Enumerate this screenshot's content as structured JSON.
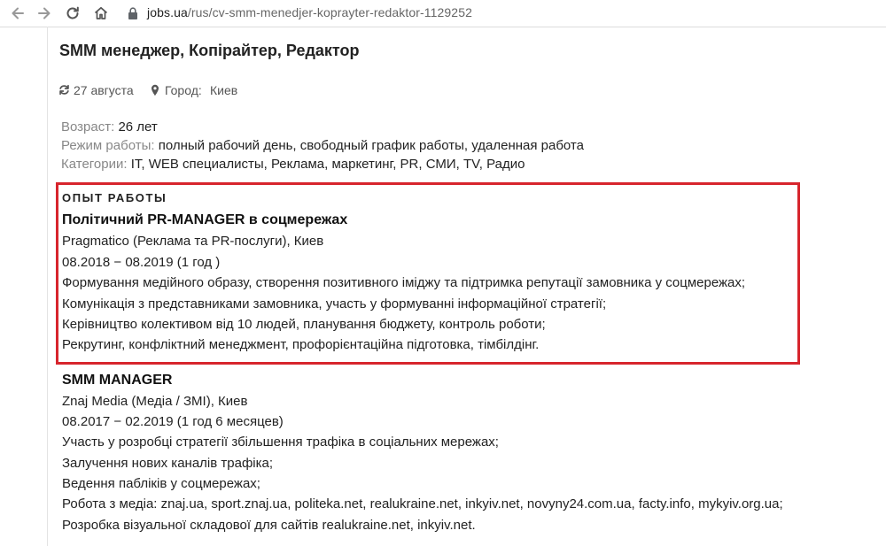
{
  "browser": {
    "url_domain": "jobs.ua",
    "url_path": "/rus/cv-smm-menedjer-koprayter-redaktor-1129252"
  },
  "resume": {
    "title": "SMM менеджер, Копірайтер, Редактор",
    "date": "27 августа",
    "city_label": "Город:",
    "city": "Киев",
    "age_label": "Возраст:",
    "age": "26 лет",
    "mode_label": "Режим работы:",
    "mode": "полный рабочий день, свободный график работы, удаленная работа",
    "categories_label": "Категории:",
    "categories": "IT, WEB специалисты, Реклама, маркетинг, PR, СМИ, TV, Радио"
  },
  "experience": {
    "section_title": "ОПЫТ РАБОТЫ",
    "jobs": [
      {
        "position": "Політичний PR-MANAGER в соцмережах",
        "company": "Pragmatico (Реклама та PR-послуги), Киев",
        "period": "08.2018 − 08.2019 (1 год )",
        "duties": [
          "Формування медійного образу, створення позитивного іміджу та підтримка репутації замовника у соцмережах;",
          "Комунікація з представниками замовника, участь у формуванні інформаційної стратегії;",
          "Керівництво колективом від 10 людей, планування бюджету, контроль роботи;",
          "Рекрутинг, конфліктний менеджмент, профорієнтаційна підготовка, тімбілдінг."
        ]
      },
      {
        "position": "SMM MANAGER",
        "company": "Znaj Media (Медіа / ЗМІ), Киев",
        "period": "08.2017 − 02.2019 (1 год 6 месяцев)",
        "duties": [
          "Участь у розробці стратегії збільшення трафіка в соціальних мережах;",
          "Залучення нових каналів трафіка;",
          "Ведення пабліків у соцмережах;",
          "Робота з медіа: znaj.ua, sport.znaj.ua, politeka.net, realukraine.net, inkyiv.net, novyny24.com.ua, facty.info, mykyiv.org.ua;",
          "Розробка візуальної складової для сайтів realukraine.net, inkyiv.net."
        ]
      }
    ]
  },
  "colors": {
    "highlight_border": "#d7252d",
    "label_gray": "#888888"
  },
  "icons": [
    "back-arrow-icon",
    "forward-arrow-icon",
    "reload-icon",
    "home-icon",
    "lock-icon",
    "refresh-icon",
    "map-marker-icon"
  ]
}
